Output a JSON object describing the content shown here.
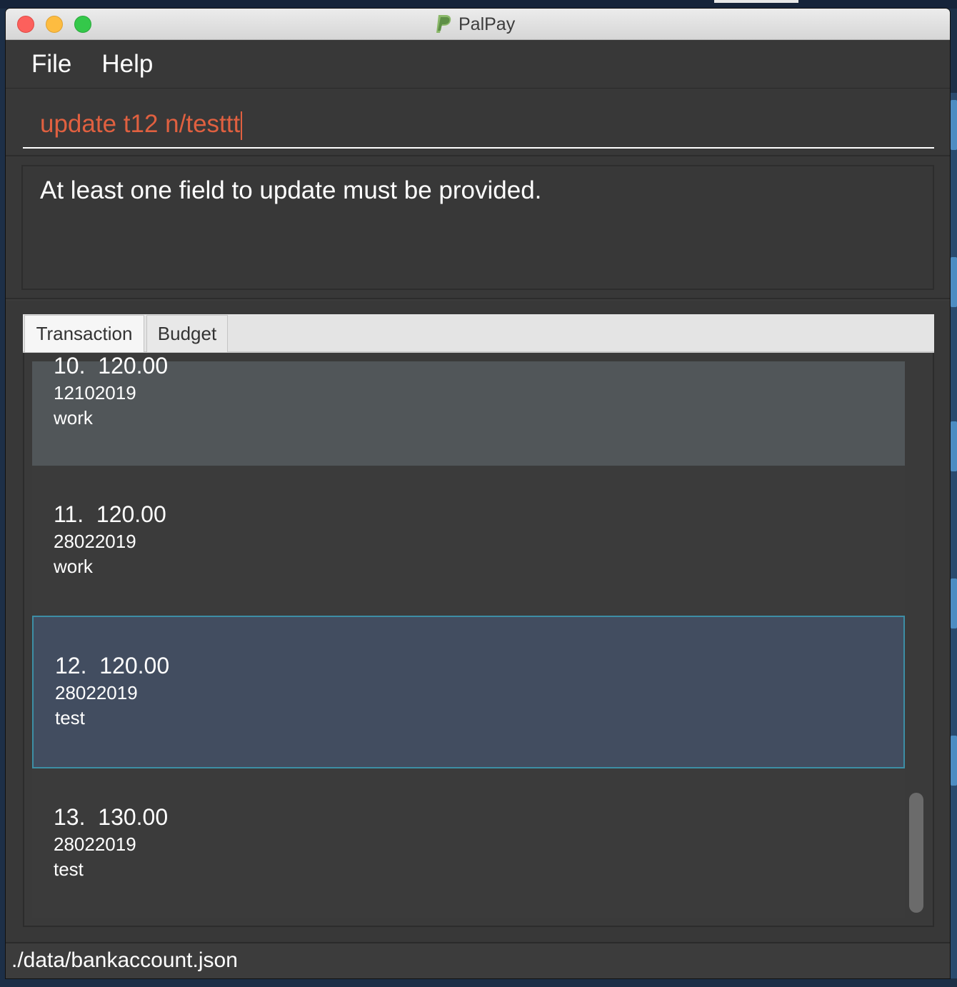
{
  "window": {
    "title": "PalPay"
  },
  "menu": {
    "file_label": "File",
    "help_label": "Help"
  },
  "command_box": {
    "value": "update t12 n/testtt"
  },
  "result_display": {
    "message": "At least one field to update must be provided."
  },
  "tabs": [
    {
      "label": "Transaction",
      "active": true
    },
    {
      "label": "Budget",
      "active": false
    }
  ],
  "transactions": [
    {
      "index": "10.",
      "amount": "120.00",
      "date": "12102019",
      "description": "work",
      "state": "hovered"
    },
    {
      "index": "11.",
      "amount": "120.00",
      "date": "28022019",
      "description": "work",
      "state": "normal"
    },
    {
      "index": "12.",
      "amount": "120.00",
      "date": "28022019",
      "description": "test",
      "state": "selected"
    },
    {
      "index": "13.",
      "amount": "130.00",
      "date": "28022019",
      "description": "test",
      "state": "normal"
    }
  ],
  "status_bar": {
    "file_path": "./data/bankaccount.json"
  },
  "colors": {
    "command_text": "#e06040",
    "selected_cell": "#424d60",
    "selected_border": "#3d8ea5",
    "hovered_cell": "#515659"
  }
}
